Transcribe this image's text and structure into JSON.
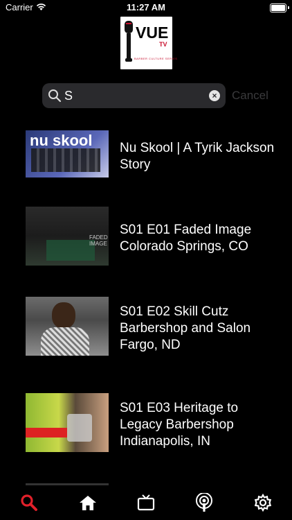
{
  "status_bar": {
    "carrier": "Carrier",
    "time": "11:27 AM"
  },
  "logo": {
    "name": "VUE",
    "sub": "TV",
    "tagline": "BARBER CULTURE SERIES"
  },
  "search": {
    "value": "S",
    "cancel_label": "Cancel"
  },
  "results": [
    {
      "title": "Nu Skool | A Tyrik Jackson Story",
      "thumb_text": "nu skool"
    },
    {
      "title": "S01 E01 Faded Image Colorado Springs, CO",
      "thumb_text": "FADED IMAGE"
    },
    {
      "title": "S01 E02 Skill Cutz Barbershop and Salon Fargo, ND"
    },
    {
      "title": "S01 E03 Heritage to Legacy Barbershop Indianapolis, IN"
    }
  ],
  "tab_bar": {
    "items": [
      "search-icon",
      "home-icon",
      "tv-icon",
      "podcast-icon",
      "settings-icon"
    ],
    "active_color": "#e1202a"
  }
}
